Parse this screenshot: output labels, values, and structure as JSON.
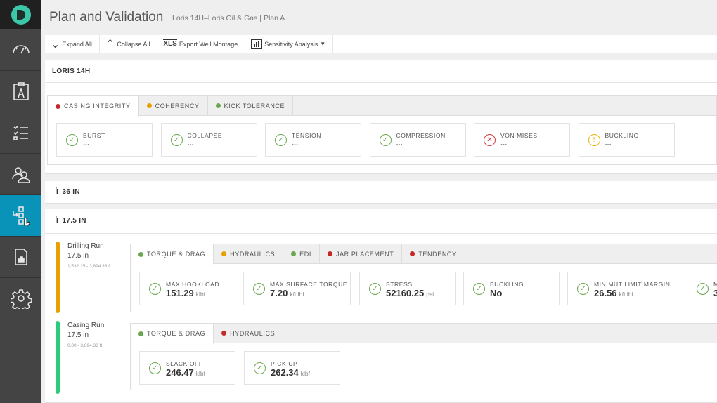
{
  "sidebar": {
    "items": [
      {
        "icon": "speedometer-icon"
      },
      {
        "icon": "well-plan-icon"
      },
      {
        "icon": "checklist-icon"
      },
      {
        "icon": "users-icon"
      },
      {
        "icon": "plan-validation-icon",
        "active": true
      },
      {
        "icon": "report-icon"
      },
      {
        "icon": "gear-icon"
      }
    ]
  },
  "header": {
    "title": "Plan and Validation",
    "subtitle": "Loris 14H–Loris Oil & Gas | Plan A"
  },
  "toolbar": {
    "expand": "Expand All",
    "collapse": "Collapse All",
    "xls": "XLS",
    "export": "Export Well Montage",
    "sensitivity": "Sensitivity Analysis"
  },
  "well": {
    "name": "LORIS 14H",
    "tabs": [
      {
        "label": "CASING INTEGRITY",
        "status": "#c62828"
      },
      {
        "label": "COHERENCY",
        "status": "#e8a000"
      },
      {
        "label": "KICK TOLERANCE",
        "status": "#6aa84f"
      }
    ],
    "cards": [
      {
        "label": "BURST",
        "value": "...",
        "status": "ok"
      },
      {
        "label": "COLLAPSE",
        "value": "...",
        "status": "ok"
      },
      {
        "label": "TENSION",
        "value": "...",
        "status": "ok"
      },
      {
        "label": "COMPRESSION",
        "value": "...",
        "status": "ok"
      },
      {
        "label": "VON MISES",
        "value": "...",
        "status": "fail"
      },
      {
        "label": "BUCKLING",
        "value": "...",
        "status": "warn"
      }
    ]
  },
  "sections": [
    {
      "label": "36 IN"
    },
    {
      "label": "17.5 IN"
    }
  ],
  "runs": [
    {
      "name": "Drilling Run",
      "size": "17.5 in",
      "range": "1,532.15 - 3,894.36 ft",
      "color": "#e8a000",
      "tabs": [
        {
          "label": "TORQUE & DRAG",
          "status": "#6aa84f"
        },
        {
          "label": "HYDRAULICS",
          "status": "#e8a000"
        },
        {
          "label": "EDI",
          "status": "#6aa84f"
        },
        {
          "label": "JAR PLACEMENT",
          "status": "#c62828"
        },
        {
          "label": "TENDENCY",
          "status": "#c62828"
        }
      ],
      "cards": [
        {
          "label": "MAX HOOKLOAD",
          "value": "151.29",
          "unit": "klbf",
          "status": "ok"
        },
        {
          "label": "MAX SURFACE TORQUE",
          "value": "7.20",
          "unit": "kft.lbf",
          "status": "ok"
        },
        {
          "label": "STRESS",
          "value": "52160.25",
          "unit": "psi",
          "status": "ok"
        },
        {
          "label": "BUCKLING",
          "value": "No",
          "unit": "",
          "status": "ok"
        },
        {
          "label": "MIN MUT LIMIT MARGIN",
          "value": "26.56",
          "unit": "kft.lbf",
          "status": "ok"
        },
        {
          "label": "M",
          "value": "3",
          "unit": "",
          "status": "ok"
        }
      ]
    },
    {
      "name": "Casing Run",
      "size": "17.5 in",
      "range": "0.00 - 3,894.36 ft",
      "color": "#2ecc7a",
      "tabs": [
        {
          "label": "TORQUE & DRAG",
          "status": "#6aa84f"
        },
        {
          "label": "HYDRAULICS",
          "status": "#c62828"
        }
      ],
      "cards": [
        {
          "label": "SLACK OFF",
          "value": "246.47",
          "unit": "klbf",
          "status": "ok"
        },
        {
          "label": "PICK UP",
          "value": "262.34",
          "unit": "klbf",
          "status": "ok"
        }
      ]
    }
  ],
  "colors": {
    "ok": "#6aa84f",
    "fail": "#d0393e",
    "warn": "#e8b400",
    "active_nav": "#0a93b8"
  }
}
